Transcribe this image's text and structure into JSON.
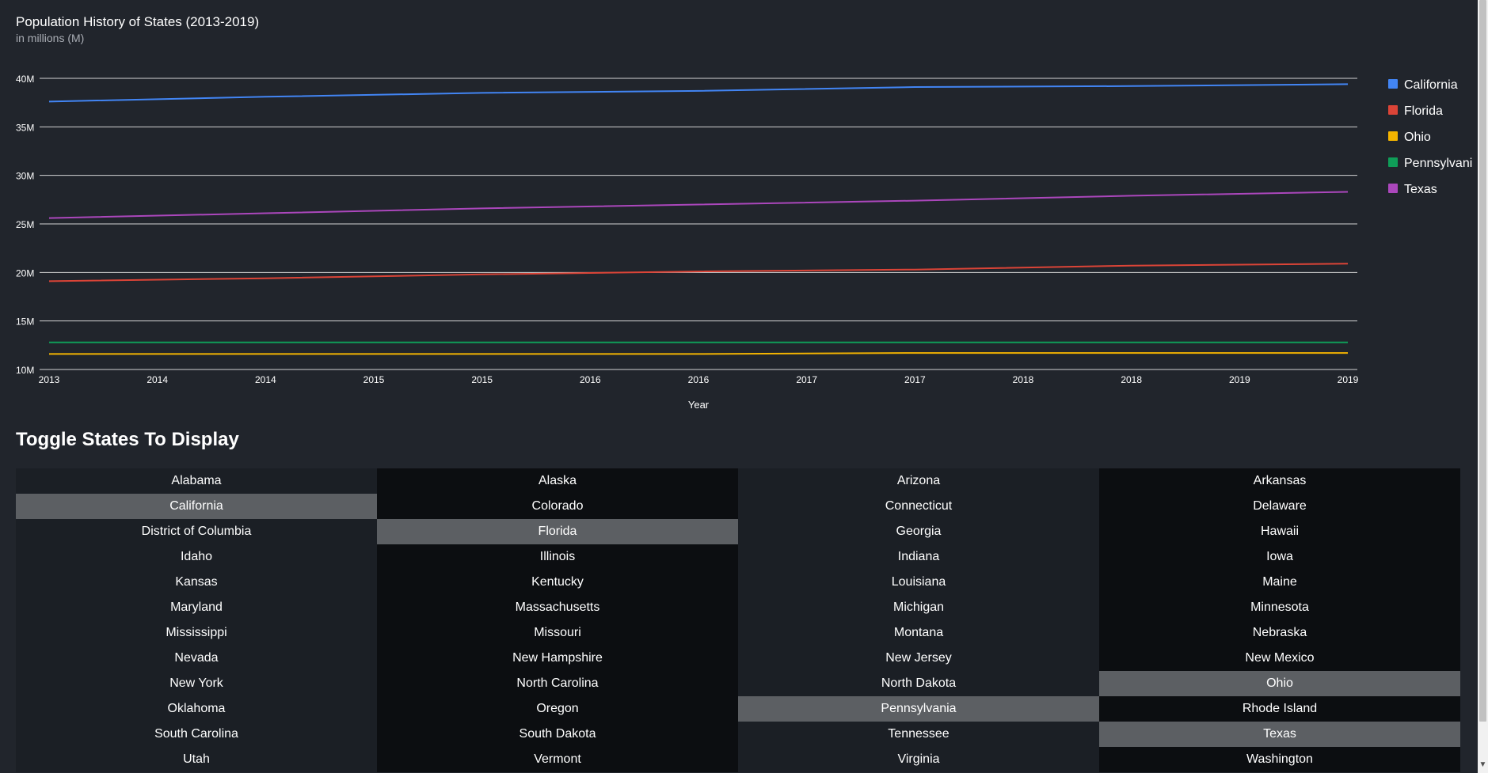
{
  "chart": {
    "title": "Population History of States (2013-2019)",
    "subtitle": "in millions (M)"
  },
  "chart_data": {
    "type": "line",
    "title": "Population History of States (2013-2019)",
    "subtitle": "in millions (M)",
    "xlabel": "Year",
    "ylabel": "",
    "x": [
      2013,
      2014,
      2014,
      2015,
      2015,
      2016,
      2016,
      2017,
      2017,
      2018,
      2018,
      2019,
      2019
    ],
    "x_tick_labels": [
      "2013",
      "2014",
      "2014",
      "2015",
      "2015",
      "2016",
      "2016",
      "2017",
      "2017",
      "2018",
      "2018",
      "2019",
      "2019"
    ],
    "ylim": [
      10,
      40
    ],
    "y_ticks": [
      10,
      15,
      20,
      25,
      30,
      35,
      40
    ],
    "y_tick_labels": [
      "10M",
      "15M",
      "20M",
      "25M",
      "30M",
      "35M",
      "40M"
    ],
    "grid": true,
    "legend_position": "right",
    "series": [
      {
        "name": "California",
        "color": "#4285f4",
        "x": [
          2013,
          2014,
          2015,
          2016,
          2017,
          2018,
          2019
        ],
        "values": [
          37.6,
          38.1,
          38.5,
          38.7,
          39.1,
          39.2,
          39.4
        ]
      },
      {
        "name": "Florida",
        "color": "#db4437",
        "x": [
          2013,
          2014,
          2015,
          2016,
          2017,
          2018,
          2019
        ],
        "values": [
          19.1,
          19.4,
          19.8,
          20.1,
          20.3,
          20.7,
          20.9
        ]
      },
      {
        "name": "Ohio",
        "color": "#f4b400",
        "x": [
          2013,
          2014,
          2015,
          2016,
          2017,
          2018,
          2019
        ],
        "values": [
          11.6,
          11.6,
          11.6,
          11.6,
          11.7,
          11.7,
          11.7
        ]
      },
      {
        "name": "Pennsylvani",
        "color": "#0f9d58",
        "x": [
          2013,
          2014,
          2015,
          2016,
          2017,
          2018,
          2019
        ],
        "values": [
          12.8,
          12.8,
          12.8,
          12.8,
          12.8,
          12.8,
          12.8
        ]
      },
      {
        "name": "Texas",
        "color": "#ab47bc",
        "x": [
          2013,
          2014,
          2015,
          2016,
          2017,
          2018,
          2019
        ],
        "values": [
          25.6,
          26.1,
          26.6,
          27.0,
          27.4,
          27.9,
          28.3
        ]
      }
    ]
  },
  "toggle_section": {
    "title": "Toggle States To Display"
  },
  "states": [
    {
      "name": "Alabama",
      "active": false
    },
    {
      "name": "Alaska",
      "active": false
    },
    {
      "name": "Arizona",
      "active": false
    },
    {
      "name": "Arkansas",
      "active": false
    },
    {
      "name": "California",
      "active": true
    },
    {
      "name": "Colorado",
      "active": false
    },
    {
      "name": "Connecticut",
      "active": false
    },
    {
      "name": "Delaware",
      "active": false
    },
    {
      "name": "District of Columbia",
      "active": false
    },
    {
      "name": "Florida",
      "active": true
    },
    {
      "name": "Georgia",
      "active": false
    },
    {
      "name": "Hawaii",
      "active": false
    },
    {
      "name": "Idaho",
      "active": false
    },
    {
      "name": "Illinois",
      "active": false
    },
    {
      "name": "Indiana",
      "active": false
    },
    {
      "name": "Iowa",
      "active": false
    },
    {
      "name": "Kansas",
      "active": false
    },
    {
      "name": "Kentucky",
      "active": false
    },
    {
      "name": "Louisiana",
      "active": false
    },
    {
      "name": "Maine",
      "active": false
    },
    {
      "name": "Maryland",
      "active": false
    },
    {
      "name": "Massachusetts",
      "active": false
    },
    {
      "name": "Michigan",
      "active": false
    },
    {
      "name": "Minnesota",
      "active": false
    },
    {
      "name": "Mississippi",
      "active": false
    },
    {
      "name": "Missouri",
      "active": false
    },
    {
      "name": "Montana",
      "active": false
    },
    {
      "name": "Nebraska",
      "active": false
    },
    {
      "name": "Nevada",
      "active": false
    },
    {
      "name": "New Hampshire",
      "active": false
    },
    {
      "name": "New Jersey",
      "active": false
    },
    {
      "name": "New Mexico",
      "active": false
    },
    {
      "name": "New York",
      "active": false
    },
    {
      "name": "North Carolina",
      "active": false
    },
    {
      "name": "North Dakota",
      "active": false
    },
    {
      "name": "Ohio",
      "active": true
    },
    {
      "name": "Oklahoma",
      "active": false
    },
    {
      "name": "Oregon",
      "active": false
    },
    {
      "name": "Pennsylvania",
      "active": true
    },
    {
      "name": "Rhode Island",
      "active": false
    },
    {
      "name": "South Carolina",
      "active": false
    },
    {
      "name": "South Dakota",
      "active": false
    },
    {
      "name": "Tennessee",
      "active": false
    },
    {
      "name": "Texas",
      "active": true
    },
    {
      "name": "Utah",
      "active": false
    },
    {
      "name": "Vermont",
      "active": false
    },
    {
      "name": "Virginia",
      "active": false
    },
    {
      "name": "Washington",
      "active": false
    }
  ],
  "colors": {
    "background": "#21252c",
    "active_toggle": "#5c5f63",
    "grid": "#e6e6e6"
  }
}
